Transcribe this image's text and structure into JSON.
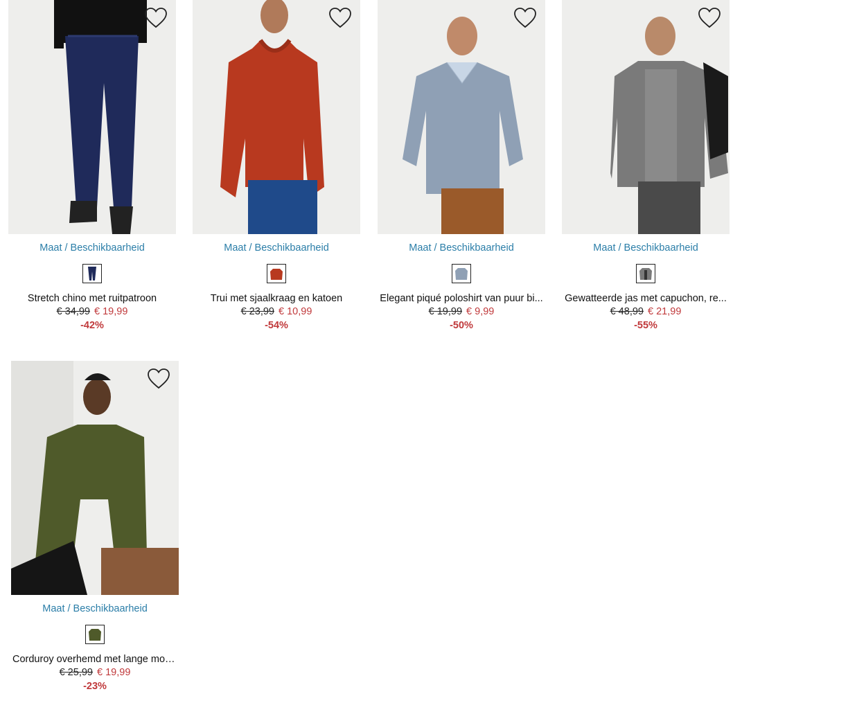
{
  "products": [
    {
      "size_link": "Maat / Beschikbaarheid",
      "title": "Stretch chino met ruitpatroon",
      "old_price": "€ 34,99",
      "new_price": "€ 19,99",
      "discount": "-42%",
      "swatch_color": "#1f2a5a"
    },
    {
      "size_link": "Maat / Beschikbaarheid",
      "title": "Trui met sjaalkraag en katoen",
      "old_price": "€ 23,99",
      "new_price": "€ 10,99",
      "discount": "-54%",
      "swatch_color": "#b8391f"
    },
    {
      "size_link": "Maat / Beschikbaarheid",
      "title": "Elegant piqué poloshirt van puur bi...",
      "old_price": "€ 19,99",
      "new_price": "€ 9,99",
      "discount": "-50%",
      "swatch_color": "#8fa0b5"
    },
    {
      "size_link": "Maat / Beschikbaarheid",
      "title": "Gewatteerde jas met capuchon, re...",
      "old_price": "€ 48,99",
      "new_price": "€ 21,99",
      "discount": "-55%",
      "swatch_color": "#7a7a7a"
    },
    {
      "size_link": "Maat / Beschikbaarheid",
      "title": "Corduroy overhemd met lange mou...",
      "old_price": "€ 25,99",
      "new_price": "€ 19,99",
      "discount": "-23%",
      "swatch_color": "#4f5a2a"
    }
  ],
  "colors": {
    "link": "#2b7ea8",
    "sale": "#c0393b"
  },
  "icons": {
    "wishlist": "heart-outline-icon"
  }
}
